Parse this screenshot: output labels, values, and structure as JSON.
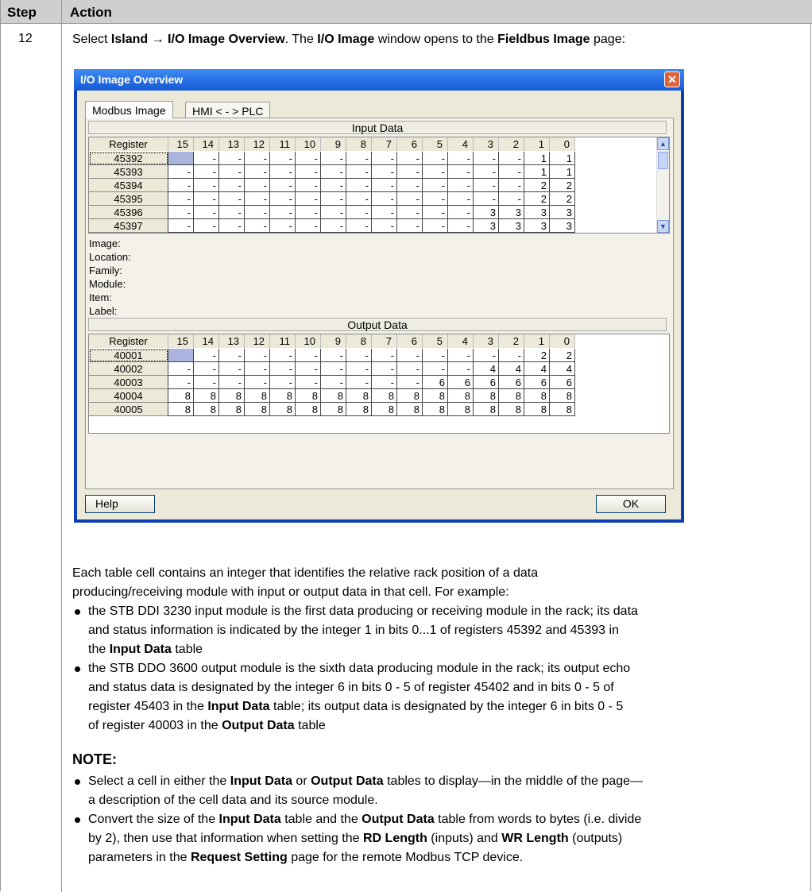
{
  "table_header": {
    "step": "Step",
    "action": "Action"
  },
  "step_number": "12",
  "intro": {
    "p1": "Select ",
    "island": "Island",
    "arrow": " → ",
    "overview": "I/O Image Overview",
    "p2": ". The ",
    "io_image": "I/O Image",
    "p3": " window opens to the ",
    "fieldbus": "Fieldbus Image",
    "p4": " page:"
  },
  "dialog": {
    "title": "I/O Image Overview",
    "close_glyph": "✕",
    "tabs": [
      "Modbus Image",
      "HMI < - > PLC"
    ],
    "input_title": "Input Data",
    "output_title": "Output Data",
    "col_header_register": "Register",
    "bits": [
      "15",
      "14",
      "13",
      "12",
      "11",
      "10",
      "9",
      "8",
      "7",
      "6",
      "5",
      "4",
      "3",
      "2",
      "1",
      "0"
    ],
    "input_rows": [
      {
        "register": "45392",
        "cells": [
          "",
          "-",
          "-",
          "-",
          "-",
          "-",
          "-",
          "-",
          "-",
          "-",
          "-",
          "-",
          "-",
          "-",
          "1",
          "1"
        ]
      },
      {
        "register": "45393",
        "cells": [
          "-",
          "-",
          "-",
          "-",
          "-",
          "-",
          "-",
          "-",
          "-",
          "-",
          "-",
          "-",
          "-",
          "-",
          "1",
          "1"
        ]
      },
      {
        "register": "45394",
        "cells": [
          "-",
          "-",
          "-",
          "-",
          "-",
          "-",
          "-",
          "-",
          "-",
          "-",
          "-",
          "-",
          "-",
          "-",
          "2",
          "2"
        ]
      },
      {
        "register": "45395",
        "cells": [
          "-",
          "-",
          "-",
          "-",
          "-",
          "-",
          "-",
          "-",
          "-",
          "-",
          "-",
          "-",
          "-",
          "-",
          "2",
          "2"
        ]
      },
      {
        "register": "45396",
        "cells": [
          "-",
          "-",
          "-",
          "-",
          "-",
          "-",
          "-",
          "-",
          "-",
          "-",
          "-",
          "-",
          "3",
          "3",
          "3",
          "3"
        ]
      },
      {
        "register": "45397",
        "cells": [
          "-",
          "-",
          "-",
          "-",
          "-",
          "-",
          "-",
          "-",
          "-",
          "-",
          "-",
          "-",
          "3",
          "3",
          "3",
          "3"
        ]
      }
    ],
    "info_labels": [
      "Image:",
      "Location:",
      "Family:",
      "Module:",
      "Item:",
      "Label:"
    ],
    "output_rows": [
      {
        "register": "40001",
        "cells": [
          "",
          "-",
          "-",
          "-",
          "-",
          "-",
          "-",
          "-",
          "-",
          "-",
          "-",
          "-",
          "-",
          "-",
          "2",
          "2"
        ]
      },
      {
        "register": "40002",
        "cells": [
          "-",
          "-",
          "-",
          "-",
          "-",
          "-",
          "-",
          "-",
          "-",
          "-",
          "-",
          "-",
          "4",
          "4",
          "4",
          "4"
        ]
      },
      {
        "register": "40003",
        "cells": [
          "-",
          "-",
          "-",
          "-",
          "-",
          "-",
          "-",
          "-",
          "-",
          "-",
          "6",
          "6",
          "6",
          "6",
          "6",
          "6"
        ]
      },
      {
        "register": "40004",
        "cells": [
          "8",
          "8",
          "8",
          "8",
          "8",
          "8",
          "8",
          "8",
          "8",
          "8",
          "8",
          "8",
          "8",
          "8",
          "8",
          "8"
        ]
      },
      {
        "register": "40005",
        "cells": [
          "8",
          "8",
          "8",
          "8",
          "8",
          "8",
          "8",
          "8",
          "8",
          "8",
          "8",
          "8",
          "8",
          "8",
          "8",
          "8"
        ]
      }
    ],
    "help_button": "Help",
    "ok_button": "OK",
    "scroll_up_glyph": "▲",
    "scroll_down_glyph": "▼"
  },
  "body": {
    "para1_line1": "Each table cell contains an integer that identifies the relative rack position of a data",
    "para1_line2": "producing/receiving module with input or output data in that cell. For example:",
    "b1_l1": "the STB DDI 3230 input module is the first data producing or receiving module in the rack; its data",
    "b1_l2": "and status information is indicated by the integer 1 in bits 0...1 of registers 45392 and 45393 in",
    "b1_l3a": "the ",
    "b1_l3b": "Input Data",
    "b1_l3c": " table",
    "b2_l1": "the STB DDO 3600 output module is the sixth data producing module in the rack; its output echo",
    "b2_l2": "and status data is designated by the integer 6 in bits 0 - 5 of register 45402 and in bits 0 - 5 of",
    "b2_l3a": "register 45403 in the ",
    "b2_l3b": "Input Data",
    "b2_l3c": " table; its output data is designated by the integer 6 in bits 0 - 5",
    "b2_l4a": "of register 40003 in the ",
    "b2_l4b": "Output Data",
    "b2_l4c": " table",
    "note_title": "NOTE:",
    "n1_l1a": "Select a cell in either the ",
    "n1_l1b": "Input Data",
    "n1_l1c": " or ",
    "n1_l1d": "Output Data",
    "n1_l1e": " tables to display—in the middle of the page—",
    "n1_l2": "a description of the cell data and its source module.",
    "n2_l1a": "Convert the size of the ",
    "n2_l1b": "Input Data",
    "n2_l1c": " table and the ",
    "n2_l1d": "Output Data",
    "n2_l1e": " table from words to bytes (i.e. divide",
    "n2_l2a": "by 2), then use that information when setting the ",
    "n2_l2b": "RD Length",
    "n2_l2c": " (inputs) and ",
    "n2_l2d": "WR Length",
    "n2_l2e": " (outputs)",
    "n2_l3a": "parameters in the ",
    "n2_l3b": "Request Setting",
    "n2_l3c": " page for the remote Modbus TCP device."
  }
}
